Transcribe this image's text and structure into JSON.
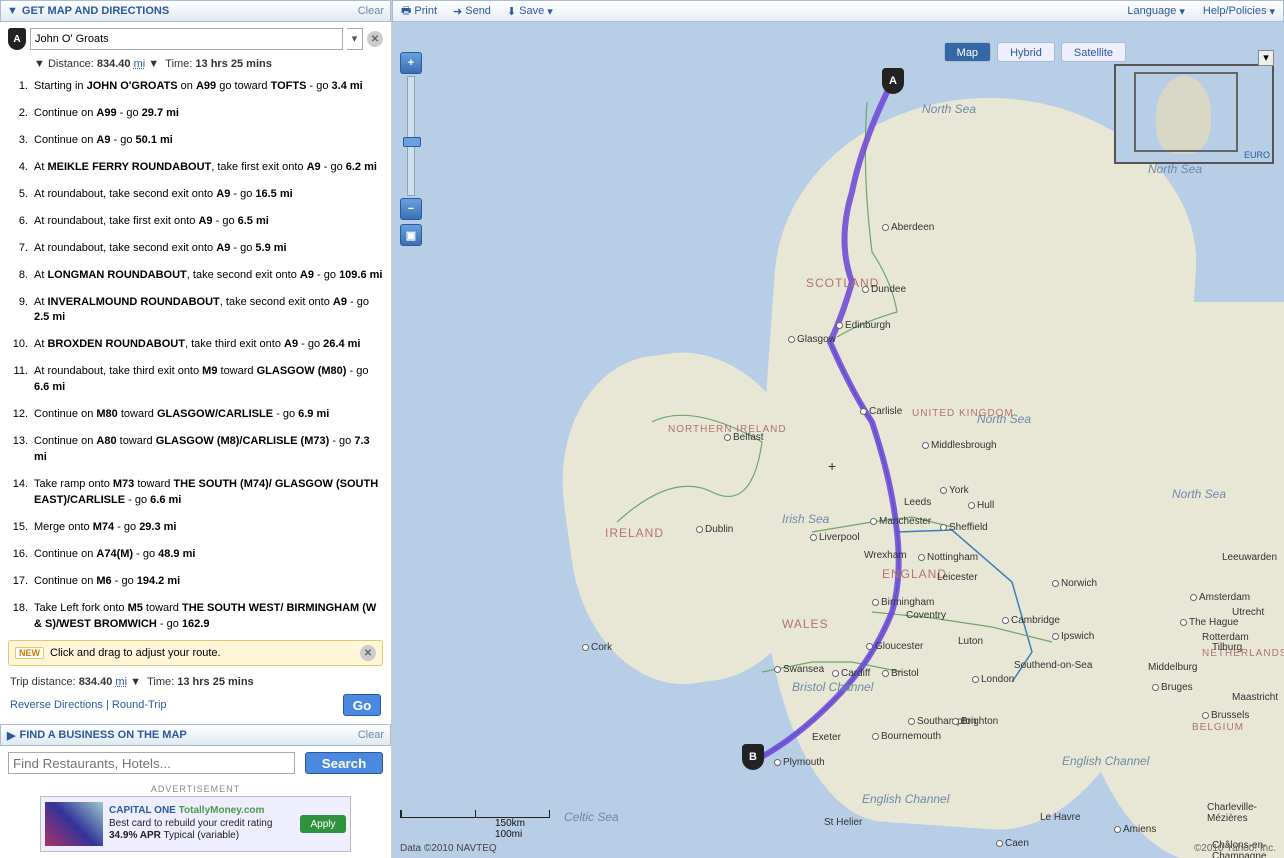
{
  "header": {
    "title": "GET MAP AND DIRECTIONS",
    "clear": "Clear"
  },
  "origin": {
    "marker": "A",
    "value": "John O' Groats"
  },
  "summary": {
    "distance_label": "Distance:",
    "distance": "834.40",
    "unit": "mi",
    "time_label": "Time:",
    "time": "13 hrs 25 mins"
  },
  "steps": [
    {
      "n": "1.",
      "html": "Starting in <b>JOHN O'GROATS</b> on <b>A99</b> go toward <b>TOFTS</b> - go <b>3.4 mi</b>"
    },
    {
      "n": "2.",
      "html": "Continue on <b>A99</b> - go <b>29.7 mi</b>"
    },
    {
      "n": "3.",
      "html": "Continue on <b>A9</b> - go <b>50.1 mi</b>"
    },
    {
      "n": "4.",
      "html": "At <b>MEIKLE FERRY ROUNDABOUT</b>, take first exit onto <b>A9</b> - go <b>6.2 mi</b>"
    },
    {
      "n": "5.",
      "html": "At roundabout, take second exit onto <b>A9</b> - go <b>16.5 mi</b>"
    },
    {
      "n": "6.",
      "html": "At roundabout, take first exit onto <b>A9</b> - go <b>6.5 mi</b>"
    },
    {
      "n": "7.",
      "html": "At roundabout, take second exit onto <b>A9</b> - go <b>5.9 mi</b>"
    },
    {
      "n": "8.",
      "html": "At <b>LONGMAN ROUNDABOUT</b>, take second exit onto <b>A9</b> - go <b>109.6 mi</b>"
    },
    {
      "n": "9.",
      "html": "At <b>INVERALMOUND ROUNDABOUT</b>, take second exit onto <b>A9</b> - go <b>2.5 mi</b>"
    },
    {
      "n": "10.",
      "html": "At <b>BROXDEN ROUNDABOUT</b>, take third exit onto <b>A9</b> - go <b>26.4 mi</b>"
    },
    {
      "n": "11.",
      "html": "At roundabout, take third exit onto <b>M9</b> toward <b>GLASGOW (M80)</b> - go <b>6.6 mi</b>"
    },
    {
      "n": "12.",
      "html": "Continue on <b>M80</b> toward <b>GLASGOW/CARLISLE</b> - go <b>6.9 mi</b>"
    },
    {
      "n": "13.",
      "html": "Continue on <b>A80</b> toward <b>GLASGOW (M8)/CARLISLE (M73)</b> - go <b>7.3 mi</b>"
    },
    {
      "n": "14.",
      "html": "Take ramp onto <b>M73</b> toward <b>THE SOUTH (M74)/ GLASGOW (SOUTH EAST)/CARLISLE</b> - go <b>6.6 mi</b>"
    },
    {
      "n": "15.",
      "html": "Merge onto <b>M74</b> - go <b>29.3 mi</b>"
    },
    {
      "n": "16.",
      "html": "Continue on <b>A74(M)</b> - go <b>48.9 mi</b>"
    },
    {
      "n": "17.",
      "html": "Continue on <b>M6</b> - go <b>194.2 mi</b>"
    },
    {
      "n": "18.",
      "html": "Take Left fork onto <b>M5</b> toward <b>THE SOUTH WEST/ BIRMINGHAM (W & S)/WEST BROMWICH</b> - go <b>162.9</b>"
    }
  ],
  "tip": {
    "badge": "NEW",
    "text": "Click and drag to adjust your route."
  },
  "trip": {
    "label": "Trip distance:",
    "distance": "834.40",
    "unit": "mi",
    "time_label": "Time:",
    "time": "13 hrs 25 mins"
  },
  "links": {
    "reverse": "Reverse Directions",
    "round": "Round-Trip",
    "go": "Go"
  },
  "biz": {
    "title": "FIND A BUSINESS ON THE MAP",
    "clear": "Clear",
    "placeholder": "Find Restaurants, Hotels...",
    "search": "Search"
  },
  "ad": {
    "label": "ADVERTISEMENT",
    "brand": "CAPITAL ONE",
    "tag": "TotallyMoney.com",
    "line1": "Best card to rebuild your credit rating",
    "line2": "34.9% APR",
    "line3": "Typical (variable)",
    "apply": "Apply"
  },
  "toolbar": {
    "print": "Print",
    "send": "Send",
    "save": "Save",
    "lang": "Language",
    "help": "Help/Policies"
  },
  "views": {
    "map": "Map",
    "hybrid": "Hybrid",
    "satellite": "Satellite"
  },
  "pins": {
    "A": "A",
    "B": "B"
  },
  "scale": {
    "km": "150km",
    "mi": "100mi"
  },
  "attr": "Data ©2010 NAVTEQ",
  "copyright": "©2010 Yahoo! Inc.",
  "mini_label": "EURO",
  "seas": {
    "north1": "North Sea",
    "north2": "North Sea",
    "north3": "North Sea",
    "irish": "Irish Sea",
    "celtic": "Celtic Sea",
    "engch": "English Channel",
    "engch2": "English Channel",
    "bristol": "Bristol Channel"
  },
  "countries": {
    "scotland": "SCOTLAND",
    "england": "ENGLAND",
    "wales": "WALES",
    "ireland": "IRELAND",
    "ni": "NORTHERN IRELAND",
    "uk": "UNITED KINGDOM",
    "nl": "NETHERLANDS",
    "be": "BELGIUM"
  },
  "cities": {
    "aberdeen": "Aberdeen",
    "dundee": "Dundee",
    "edinburgh": "Edinburgh",
    "glasgow": "Glasgow",
    "carlisle": "Carlisle",
    "belfast": "Belfast",
    "dublin": "Dublin",
    "cork": "Cork",
    "york": "York",
    "hull": "Hull",
    "leeds": "Leeds",
    "manchester": "Manchester",
    "liverpool": "Liverpool",
    "sheffield": "Sheffield",
    "nottingham": "Nottingham",
    "wrexham": "Wrexham",
    "birmingham": "Birmingham",
    "coventry": "Coventry",
    "leicester": "Leicester",
    "cambridge": "Cambridge",
    "norwich": "Norwich",
    "ipswich": "Ipswich",
    "luton": "Luton",
    "london": "London",
    "gloucester": "Gloucester",
    "cardiff": "Cardiff",
    "bristol": "Bristol",
    "swansea": "Swansea",
    "southampton": "Southampton",
    "bournemouth": "Bournemouth",
    "brighton": "Brighton",
    "plymouth": "Plymouth",
    "exeter": "Exeter",
    "sthelier": "St Helier",
    "middlesbrough": "Middlesbrough",
    "southend": "Southend-on-Sea",
    "caen": "Caen",
    "lehavre": "Le Havre",
    "amiens": "Amiens",
    "amsterdam": "Amsterdam",
    "thehague": "The Hague",
    "rotterdam": "Rotterdam",
    "utrecht": "Utrecht",
    "brussels": "Brussels",
    "bruges": "Bruges",
    "tilburg": "Tilburg",
    "middelburg": "Middelburg",
    "leeuwarden": "Leeuwarden",
    "maastricht": "Maastricht",
    "chalons": "Châlons-en-Champagne",
    "charleville": "Charleville-Mézières"
  }
}
